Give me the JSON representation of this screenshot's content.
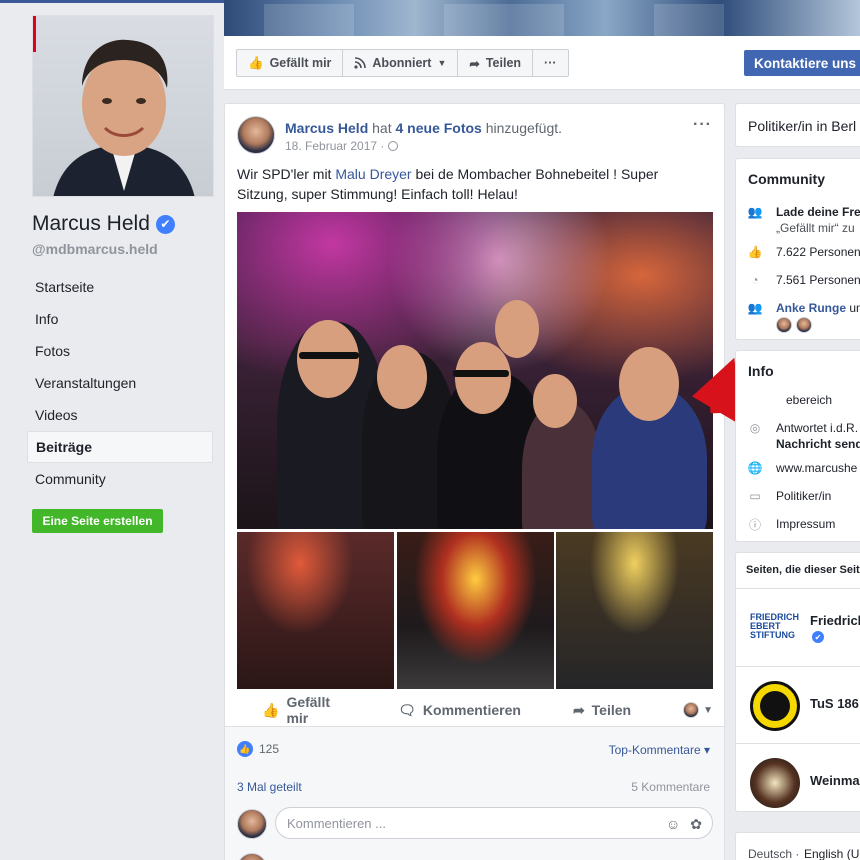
{
  "page": {
    "name": "Marcus Held",
    "handle": "@mdbmarcus.held"
  },
  "actions": {
    "like": "Gefällt mir",
    "subscribe": "Abonniert",
    "share": "Teilen",
    "more": "···",
    "contact": "Kontaktiere uns"
  },
  "nav": [
    {
      "label": "Startseite"
    },
    {
      "label": "Info"
    },
    {
      "label": "Fotos"
    },
    {
      "label": "Veranstaltungen"
    },
    {
      "label": "Videos"
    },
    {
      "label": "Beiträge",
      "active": true
    },
    {
      "label": "Community"
    }
  ],
  "create_page": "Eine Seite erstellen",
  "post": {
    "author": "Marcus Held",
    "action_pre": "hat",
    "action_link": "4 neue Fotos",
    "action_post": "hinzugefügt.",
    "date": "18. Februar 2017 ·",
    "menu": "···",
    "text_pre": "Wir SPD'ler mit",
    "text_tag": "Malu Dreyer",
    "text_post": "bei de Mombacher Bohnebeitel ! Super Sitzung, super Stimmung! Einfach toll! Helau!",
    "like_btn": "Gefällt mir",
    "comment_btn": "Kommentieren",
    "share_btn": "Teilen",
    "reactions": "125",
    "top_comments": "Top-Kommentare ▾",
    "shares": "3 Mal geteilt",
    "comments_count": "5 Kommentare",
    "comment_placeholder": "Kommentieren ..."
  },
  "sidebar": {
    "category": "Politiker/in in Berl",
    "community_title": "Community",
    "community_rows": [
      {
        "icon": "invite-icon",
        "text": "Lade deine Fre",
        "link": true
      },
      {
        "icon": "",
        "text": "„Gefällt mir“ zu",
        "link": false
      },
      {
        "icon": "like-icon",
        "text": "7.622 Personen",
        "link": false
      },
      {
        "icon": "rss-icon",
        "text": "7.561 Personen",
        "link": false
      },
      {
        "icon": "people-icon",
        "text_link": "Anke Runge",
        "text_rest": " un"
      }
    ],
    "info_title": "Info",
    "info_rows": [
      {
        "icon": "",
        "text": "ebereich"
      },
      {
        "icon": "messenger-icon",
        "text": "Antwortet i.d.R."
      },
      {
        "icon": "",
        "text": "Nachricht send",
        "link": true
      },
      {
        "icon": "globe-icon",
        "text": "www.marcushe",
        "link": true
      },
      {
        "icon": "square-icon",
        "text": "Politiker/in",
        "link": true
      },
      {
        "icon": "info-icon",
        "text": "Impressum",
        "link": true
      }
    ],
    "liked_pages_title": "Seiten, die dieser Seit",
    "liked_pages": [
      {
        "name": "Friedrich",
        "logo_text": "FRIEDRICH EBERT STIFTUNG"
      },
      {
        "name": "TuS 186"
      },
      {
        "name": "Weinma"
      }
    ],
    "footer_lang": "Deutsch ·",
    "footer_lang2": "English (U"
  },
  "colors": {
    "facebook_blue": "#3b5998",
    "link_blue": "#365899",
    "button_blue": "#4267b2",
    "green": "#42b72a",
    "arrow_red": "#d8121b"
  }
}
